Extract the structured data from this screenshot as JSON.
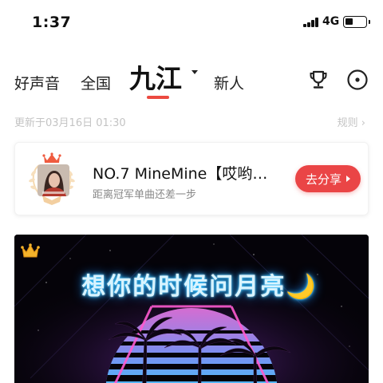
{
  "status": {
    "time": "1:37",
    "network": "4G"
  },
  "tabs": [
    {
      "label": "好声音"
    },
    {
      "label": "全国"
    },
    {
      "label": "九江",
      "active": true
    },
    {
      "label": "新人"
    }
  ],
  "header_icons": [
    "trophy-icon",
    "disc-icon"
  ],
  "update": {
    "text": "更新于03月16日 01:30",
    "rules_label": "规则 ›"
  },
  "rank_card": {
    "title": "NO.7 MineMine【哎哟…",
    "subtitle": "距离冠军单曲还差一步",
    "share_label": "去分享"
  },
  "banner": {
    "title": "想你的时候问月亮🌙"
  },
  "colors": {
    "accent": "#ec4a40",
    "share_button": "#ea4546",
    "muted_text": "#c4c4c4",
    "secondary_text": "#888888"
  }
}
